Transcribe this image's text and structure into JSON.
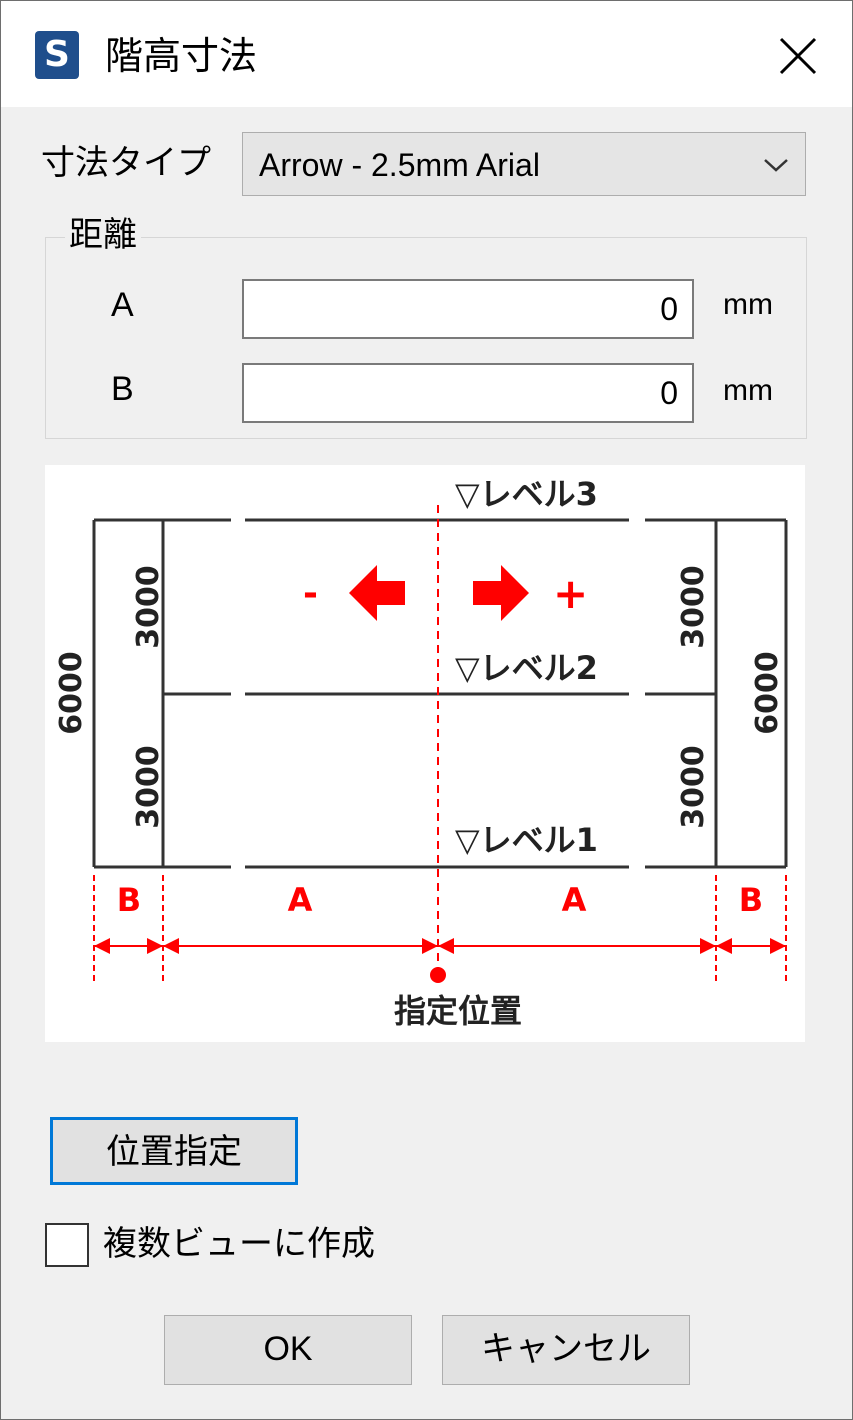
{
  "window": {
    "title": "階高寸法",
    "app_icon_letter": "S"
  },
  "dimension_type": {
    "label": "寸法タイプ",
    "selected": "Arrow - 2.5mm Arial"
  },
  "distance": {
    "legend": "距離",
    "a": {
      "label": "A",
      "value": "0",
      "unit": "mm"
    },
    "b": {
      "label": "B",
      "value": "0",
      "unit": "mm"
    }
  },
  "diagram": {
    "levels": [
      "▽レベル3",
      "▽レベル2",
      "▽レベル1"
    ],
    "dim_3000": "3000",
    "dim_6000": "6000",
    "minus": "-",
    "plus": "+",
    "label_a": "A",
    "label_b": "B",
    "specified_position": "指定位置",
    "accent_color": "#ff0000",
    "line_color": "#333333"
  },
  "buttons": {
    "position": "位置指定",
    "ok": "OK",
    "cancel": "キャンセル"
  },
  "multi_view": {
    "label": "複数ビューに作成",
    "checked": false
  }
}
